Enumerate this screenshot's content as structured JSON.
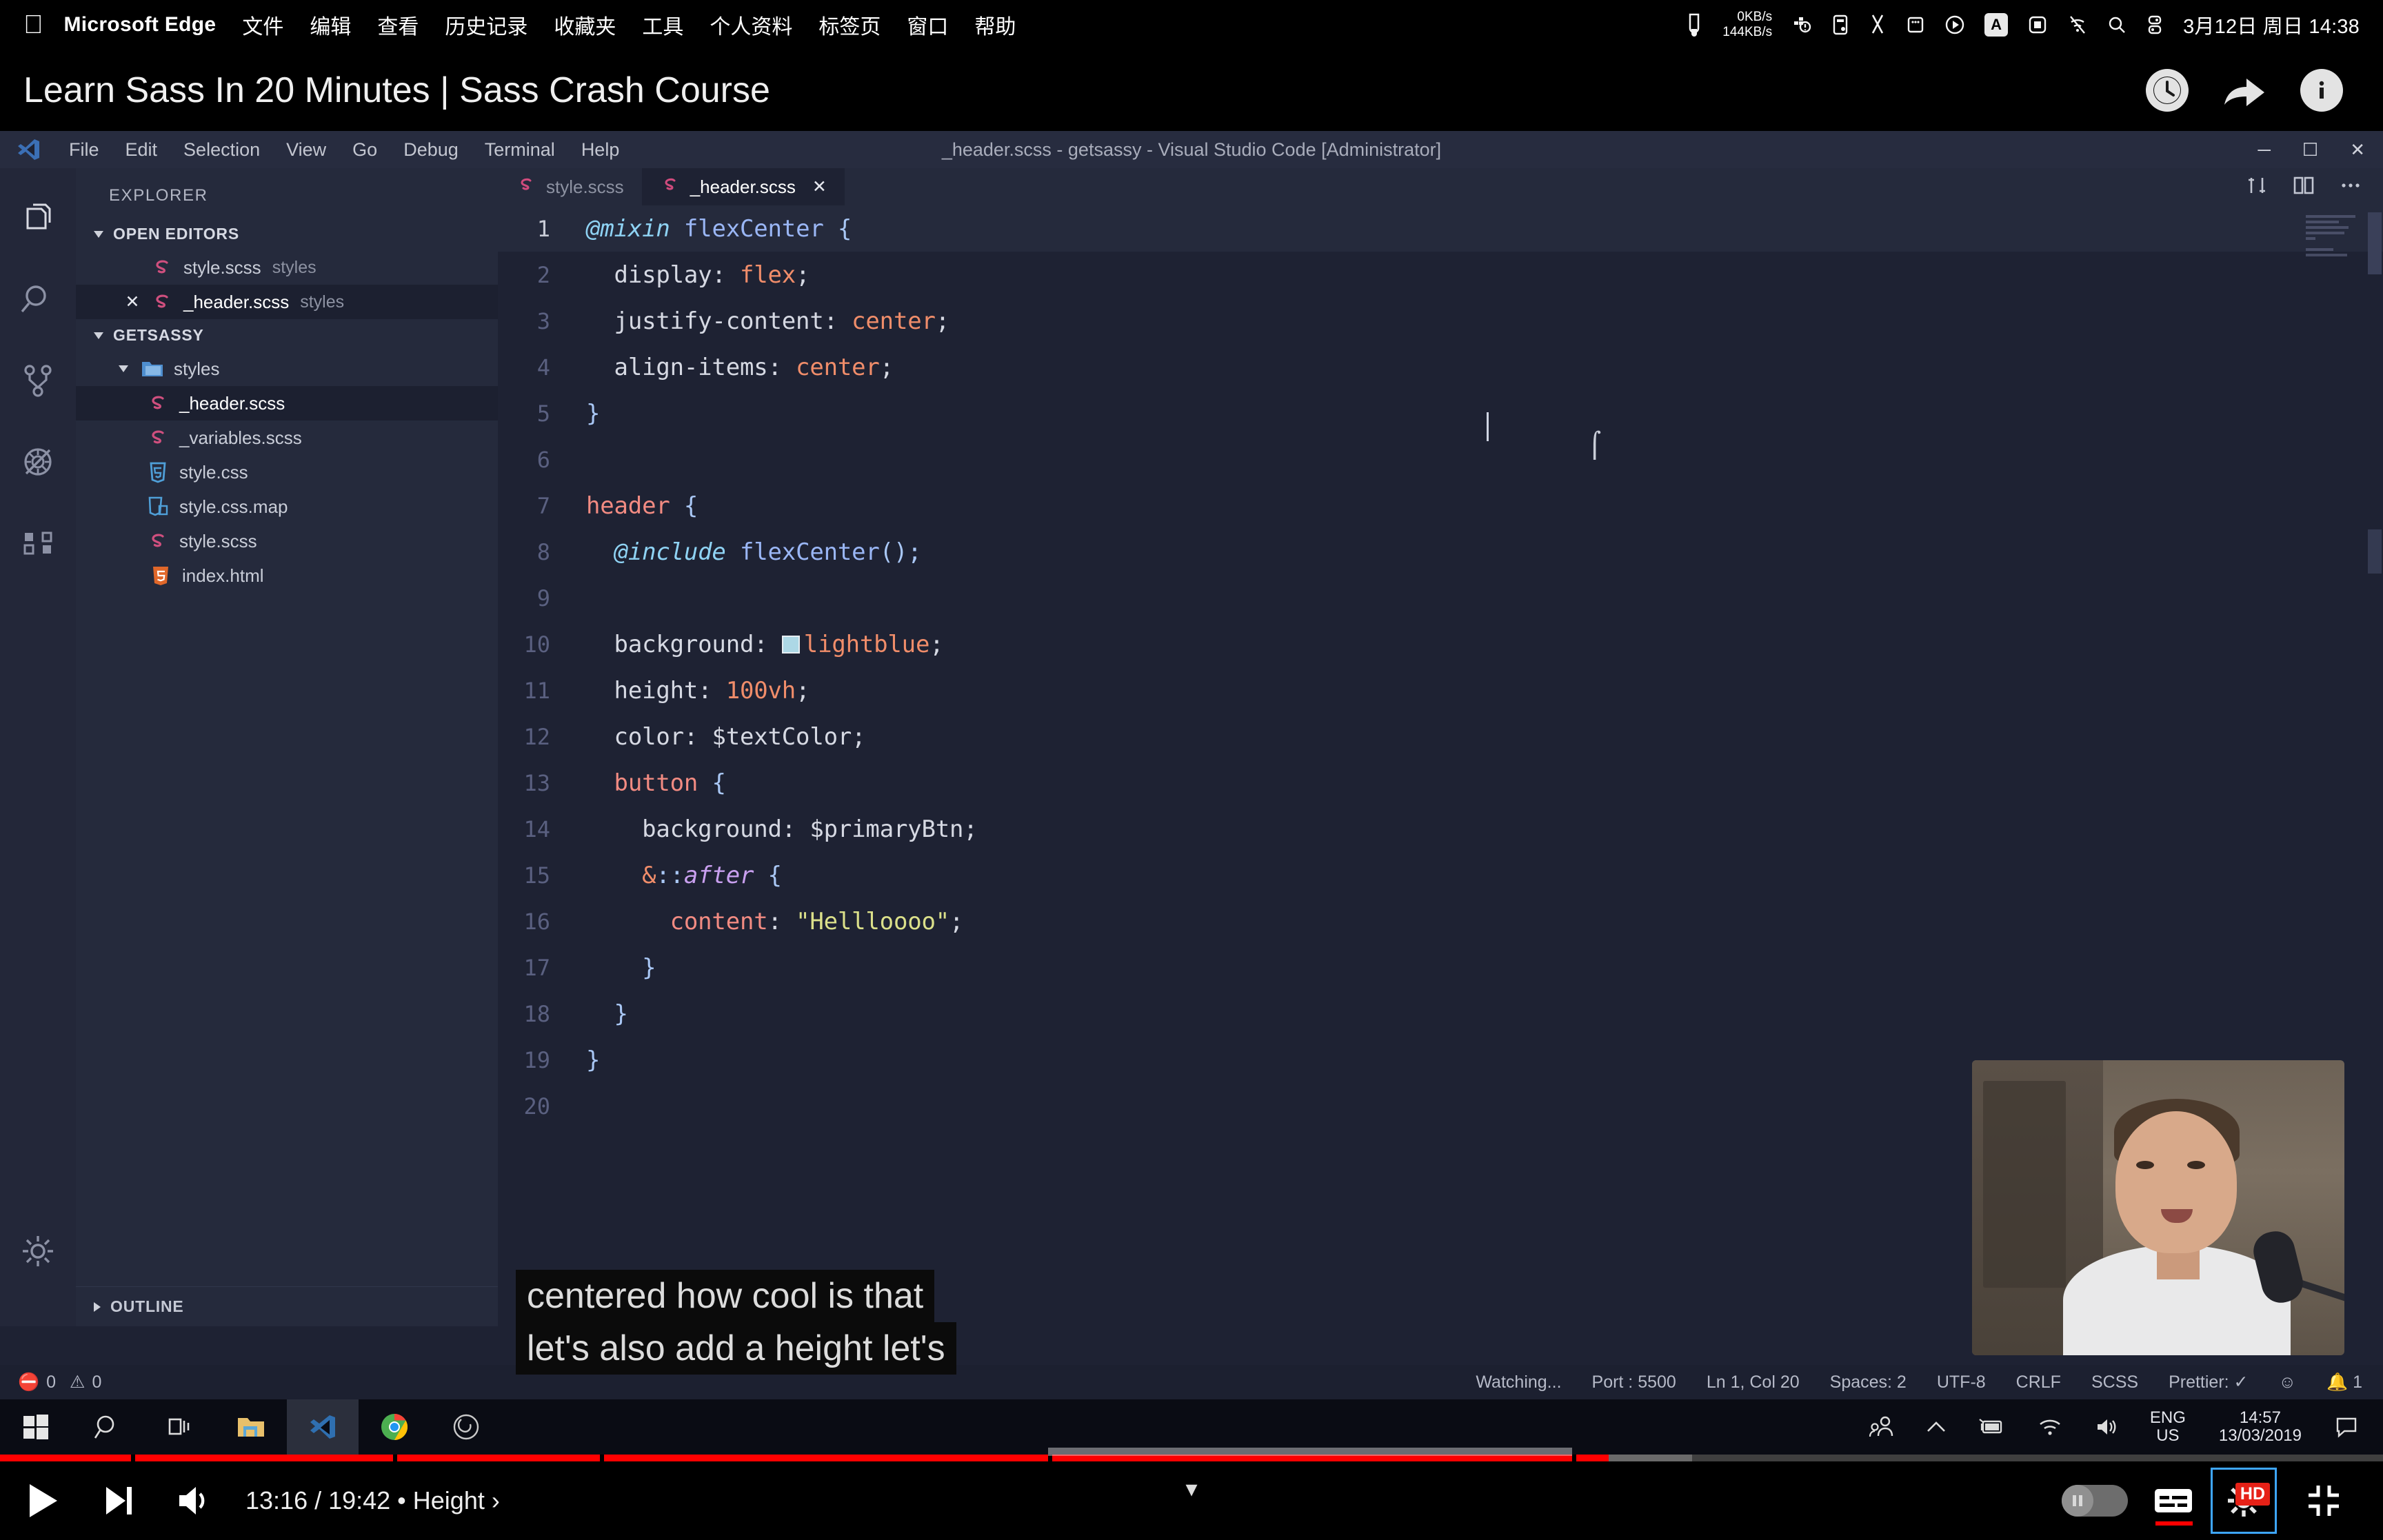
{
  "mac_menubar": {
    "apple_icon": "apple-icon",
    "app_name": "Microsoft Edge",
    "menus": [
      "文件",
      "编辑",
      "查看",
      "历史记录",
      "收藏夹",
      "工具",
      "个人资料",
      "标签页",
      "窗口",
      "帮助"
    ],
    "network_up": "0KB/s",
    "network_down": "144KB/s",
    "input_source": "A",
    "datetime": "3月12日 周日  14:38",
    "status_icons": [
      "pocket-icon",
      "network-speed-icon",
      "docker-icon",
      "battery-monitor-icon",
      "scissors-icon",
      "dropbox-icon",
      "play-circle-icon",
      "input-source-icon",
      "display-icon",
      "wifi-off-icon",
      "spotlight-search-icon",
      "control-center-icon"
    ]
  },
  "youtube_titlebar": {
    "title": "Learn Sass In 20 Minutes | Sass Crash Course",
    "actions": [
      {
        "name": "watch-later-button",
        "icon": "clock-icon"
      },
      {
        "name": "share-button",
        "icon": "share-arrow-icon"
      },
      {
        "name": "info-button",
        "icon": "info-icon"
      }
    ]
  },
  "vscode": {
    "window_title": "_header.scss - getsassy - Visual Studio Code [Administrator]",
    "menus": [
      "File",
      "Edit",
      "Selection",
      "View",
      "Go",
      "Debug",
      "Terminal",
      "Help"
    ],
    "window_controls": [
      "minimize",
      "maximize",
      "close"
    ],
    "activity_bar": [
      {
        "name": "explorer-icon",
        "label": "Explorer"
      },
      {
        "name": "search-icon",
        "label": "Search"
      },
      {
        "name": "source-control-icon",
        "label": "Source Control"
      },
      {
        "name": "debug-icon",
        "label": "Debug"
      },
      {
        "name": "extensions-icon",
        "label": "Extensions"
      },
      {
        "name": "settings-gear-icon",
        "label": "Manage"
      }
    ],
    "sidebar": {
      "title": "EXPLORER",
      "open_editors": {
        "label": "OPEN EDITORS",
        "items": [
          {
            "name": "style.scss",
            "folder": "styles",
            "icon": "sass-icon",
            "active": false,
            "dirty": false
          },
          {
            "name": "_header.scss",
            "folder": "styles",
            "icon": "sass-icon",
            "active": true,
            "dirty": false
          }
        ]
      },
      "project": {
        "label": "GETSASSY",
        "folder": {
          "name": "styles",
          "icon": "folder-icon"
        },
        "files": [
          {
            "name": "_header.scss",
            "icon": "sass-icon",
            "selected": true
          },
          {
            "name": "_variables.scss",
            "icon": "sass-icon",
            "selected": false
          },
          {
            "name": "style.css",
            "icon": "css-icon",
            "selected": false
          },
          {
            "name": "style.css.map",
            "icon": "cssmap-icon",
            "selected": false
          },
          {
            "name": "style.scss",
            "icon": "sass-icon",
            "selected": false
          }
        ],
        "root_files": [
          {
            "name": "index.html",
            "icon": "html-icon"
          }
        ]
      },
      "outline_label": "OUTLINE"
    },
    "tabs": [
      {
        "label": "style.scss",
        "icon": "sass-icon",
        "active": false,
        "closable": false
      },
      {
        "label": "_header.scss",
        "icon": "sass-icon",
        "active": true,
        "closable": true
      }
    ],
    "tab_actions": [
      "split-editor-icon",
      "open-changes-icon",
      "more-actions-icon"
    ],
    "code_lines": [
      {
        "n": "1",
        "text": "@mixin flexCenter {"
      },
      {
        "n": "2",
        "text": "  display: flex;"
      },
      {
        "n": "3",
        "text": "  justify-content: center;"
      },
      {
        "n": "4",
        "text": "  align-items: center;"
      },
      {
        "n": "5",
        "text": "}"
      },
      {
        "n": "6",
        "text": ""
      },
      {
        "n": "7",
        "text": "header {"
      },
      {
        "n": "8",
        "text": "  @include flexCenter();"
      },
      {
        "n": "9",
        "text": ""
      },
      {
        "n": "10",
        "text": "  background: lightblue;"
      },
      {
        "n": "11",
        "text": "  height: 100vh;"
      },
      {
        "n": "12",
        "text": "  color: $textColor;"
      },
      {
        "n": "13",
        "text": "  button {"
      },
      {
        "n": "14",
        "text": "    background: $primaryBtn;"
      },
      {
        "n": "15",
        "text": "    &::after {"
      },
      {
        "n": "16",
        "text": "      content: \"Hellloooo\";"
      },
      {
        "n": "17",
        "text": "    }"
      },
      {
        "n": "18",
        "text": "  }"
      },
      {
        "n": "19",
        "text": "}"
      },
      {
        "n": "20",
        "text": ""
      }
    ],
    "color_swatch_hex": "#add8e6",
    "statusbar": {
      "errors": "0",
      "warnings": "0",
      "watching": "Watching...",
      "port": "Port : 5500",
      "cursor": "Ln 1, Col 20",
      "spaces": "Spaces: 2",
      "encoding": "UTF-8",
      "eol": "CRLF",
      "language": "SCSS",
      "prettier": "Prettier: ✓",
      "feedback_icon": "smiley-icon",
      "notifications": "1"
    }
  },
  "captions": {
    "line1": "centered how cool is that",
    "line2": "let's also add a height let's"
  },
  "windows_taskbar": {
    "items": [
      {
        "name": "start-button",
        "icon": "windows-logo-icon"
      },
      {
        "name": "taskbar-search",
        "icon": "search-icon"
      },
      {
        "name": "task-view-button",
        "icon": "task-view-icon"
      },
      {
        "name": "file-explorer-button",
        "icon": "folder-icon"
      },
      {
        "name": "vscode-button",
        "icon": "vscode-icon",
        "active": true
      },
      {
        "name": "chrome-button",
        "icon": "chrome-icon"
      },
      {
        "name": "obs-button",
        "icon": "obs-icon"
      }
    ],
    "tray": [
      {
        "name": "people-icon"
      },
      {
        "name": "show-hidden-icons-chevron"
      },
      {
        "name": "battery-icon"
      },
      {
        "name": "wifi-icon"
      },
      {
        "name": "volume-icon"
      }
    ],
    "language": "ENG",
    "region": "US",
    "time": "14:57",
    "date": "13/03/2019",
    "notification_icon": "action-center-icon"
  },
  "youtube_player": {
    "progress_percent": 67.5,
    "buffer_percent": 71,
    "current_time": "13:16",
    "duration": "19:42",
    "chapter": "Height",
    "time_display": "13:16 / 19:42 • Height ›",
    "controls_left": [
      {
        "name": "play-button",
        "icon": "play-icon"
      },
      {
        "name": "next-video-button",
        "icon": "next-icon"
      },
      {
        "name": "volume-button",
        "icon": "volume-icon"
      }
    ],
    "controls_right": [
      {
        "name": "autoplay-toggle",
        "icon": "pause-toggle-icon",
        "state": "off"
      },
      {
        "name": "subtitles-button",
        "icon": "cc-icon",
        "active": true
      },
      {
        "name": "settings-button",
        "icon": "gear-icon",
        "badge": "HD",
        "focused": true
      },
      {
        "name": "exit-fullscreen-button",
        "icon": "exit-fullscreen-icon"
      }
    ],
    "expand_caret": "chevron-down-icon",
    "accent_color": "#ff0000"
  }
}
